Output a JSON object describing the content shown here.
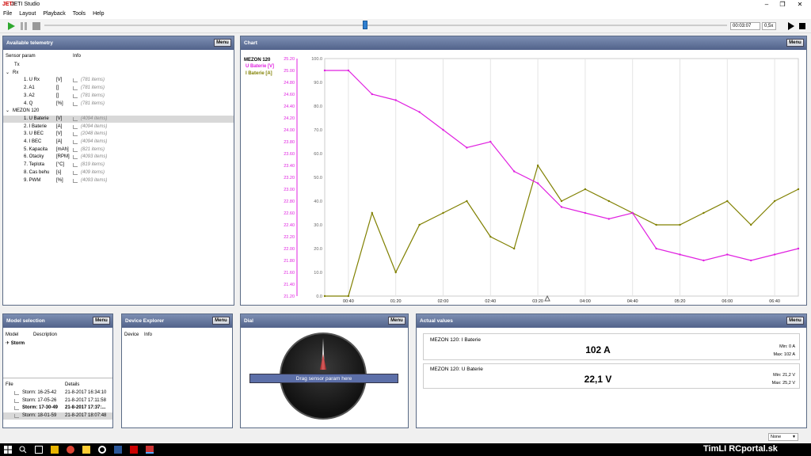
{
  "app": {
    "title": "JETI Studio",
    "logo": "JETI"
  },
  "menu": [
    "File",
    "Layout",
    "Playback",
    "Tools",
    "Help"
  ],
  "toolbar": {
    "time": "00:03:07",
    "speed": "0,5x",
    "progress": 0.47
  },
  "telemetry": {
    "title": "Available telemetry",
    "menu_label": "Menu",
    "col_sensor": "Sensor param",
    "col_info": "Info",
    "rows": [
      {
        "name": "Tx",
        "unit": "",
        "items": "",
        "level": 1,
        "group": true
      },
      {
        "name": "Rx",
        "unit": "",
        "items": "",
        "level": 0,
        "group": true,
        "expanded": true
      },
      {
        "name": "1. U Rx",
        "unit": "[V]",
        "items": "(781 items)",
        "level": 2
      },
      {
        "name": "2. A1",
        "unit": "[]",
        "items": "(781 items)",
        "level": 2
      },
      {
        "name": "3. A2",
        "unit": "[]",
        "items": "(781 items)",
        "level": 2
      },
      {
        "name": "4. Q",
        "unit": "[%]",
        "items": "(781 items)",
        "level": 2
      },
      {
        "name": "MEZON 120",
        "unit": "",
        "items": "",
        "level": 0,
        "group": true,
        "expanded": true
      },
      {
        "name": "1. U Baterie",
        "unit": "[V]",
        "items": "(4094 items)",
        "level": 2,
        "selected": true
      },
      {
        "name": "2. I Baterie",
        "unit": "[A]",
        "items": "(4094 items)",
        "level": 2
      },
      {
        "name": "3. U BEC",
        "unit": "[V]",
        "items": "(2048 items)",
        "level": 2
      },
      {
        "name": "4. I BEC",
        "unit": "[A]",
        "items": "(4094 items)",
        "level": 2
      },
      {
        "name": "5. Kapacita",
        "unit": "[mAh]",
        "items": "(821 items)",
        "level": 2
      },
      {
        "name": "6. Otacky",
        "unit": "[RPM]",
        "items": "(4093 items)",
        "level": 2
      },
      {
        "name": "7. Teplota",
        "unit": "[°C]",
        "items": "(819 items)",
        "level": 2
      },
      {
        "name": "8. Cas behu",
        "unit": "[s]",
        "items": "(409 items)",
        "level": 2
      },
      {
        "name": "9. PWM",
        "unit": "[%]",
        "items": "(4093 items)",
        "level": 2
      }
    ]
  },
  "chart": {
    "title": "Chart",
    "menu_label": "Menu",
    "legend_title": "MEZON 120",
    "series_names": [
      "U Baterie [V]",
      "I Baterie [A]"
    ],
    "colors": {
      "voltage": "#e020e0",
      "current": "#808000"
    },
    "left_ticks": [
      "25.20",
      "25.00",
      "24.80",
      "24.60",
      "24.40",
      "24.20",
      "24.00",
      "23.80",
      "23.60",
      "23.40",
      "23.20",
      "23.00",
      "22.80",
      "22.60",
      "22.40",
      "22.20",
      "22.00",
      "21.80",
      "21.60",
      "21.40",
      "21.20"
    ],
    "right_ticks": [
      "100.0",
      "90.0",
      "80.0",
      "70.0",
      "60.0",
      "50.0",
      "40.0",
      "30.0",
      "20.0",
      "10.0",
      "0.0"
    ],
    "x_ticks": [
      "00:40",
      "01:20",
      "02:00",
      "02:40",
      "03:20",
      "04:00",
      "04:40",
      "05:20",
      "06:00",
      "06:40"
    ]
  },
  "chart_data": {
    "type": "line",
    "x_unit": "mm:ss",
    "x": [
      "00:00",
      "00:20",
      "00:40",
      "01:00",
      "01:20",
      "01:40",
      "02:00",
      "02:20",
      "02:40",
      "03:00",
      "03:20",
      "03:40",
      "04:00",
      "04:20",
      "04:40",
      "05:00",
      "05:20",
      "05:40",
      "06:00",
      "06:20",
      "06:40"
    ],
    "series": [
      {
        "name": "U Baterie [V]",
        "axis": "left",
        "values": [
          25.0,
          25.0,
          24.6,
          24.5,
          24.3,
          24.0,
          23.7,
          23.8,
          23.3,
          23.1,
          22.7,
          22.6,
          22.5,
          22.6,
          22.0,
          21.9,
          21.8,
          21.9,
          21.8,
          21.9,
          22.0
        ]
      },
      {
        "name": "I Baterie [A]",
        "axis": "right",
        "values": [
          0,
          0,
          35,
          10,
          30,
          35,
          40,
          25,
          20,
          55,
          40,
          45,
          40,
          35,
          30,
          30,
          35,
          40,
          30,
          40,
          45
        ]
      }
    ],
    "left_ylim": [
      21.2,
      25.2
    ],
    "right_ylim": [
      0,
      100
    ]
  },
  "model": {
    "title": "Model selection",
    "menu_label": "Menu",
    "col_model": "Model",
    "col_desc": "Description",
    "model_name": "Storm",
    "col_file": "File",
    "col_details": "Details",
    "files": [
      {
        "file": "Storm: 16-25-42",
        "details": "21-8-2017 16:34:10",
        "bold": false,
        "selected": false
      },
      {
        "file": "Storm: 17-05-26",
        "details": "21-8-2017 17:11:58",
        "bold": false,
        "selected": false
      },
      {
        "file": "Storm: 17-30-49",
        "details": "21-8-2017 17:37:...",
        "bold": true,
        "selected": false
      },
      {
        "file": "Storm: 18-01-59",
        "details": "21-8-2017 18:07:48",
        "bold": false,
        "selected": true
      }
    ]
  },
  "device": {
    "title": "Device Explorer",
    "menu_label": "Menu",
    "col_device": "Device",
    "col_info": "Info"
  },
  "dial": {
    "title": "Dial",
    "menu_label": "Menu",
    "hint": "Drag sensor param here"
  },
  "actual": {
    "title": "Actual values",
    "menu_label": "Menu",
    "cards": [
      {
        "name": "MEZON 120: I Baterie",
        "value": "102 A",
        "min": "Min: 0 A",
        "max": "Max: 102 A"
      },
      {
        "name": "MEZON 120: U Baterie",
        "value": "22,1 V",
        "min": "Min: 21,2 V",
        "max": "Max: 25,2 V"
      }
    ]
  },
  "status": {
    "combo": "None"
  },
  "watermark": "TimLI RCportal.sk"
}
